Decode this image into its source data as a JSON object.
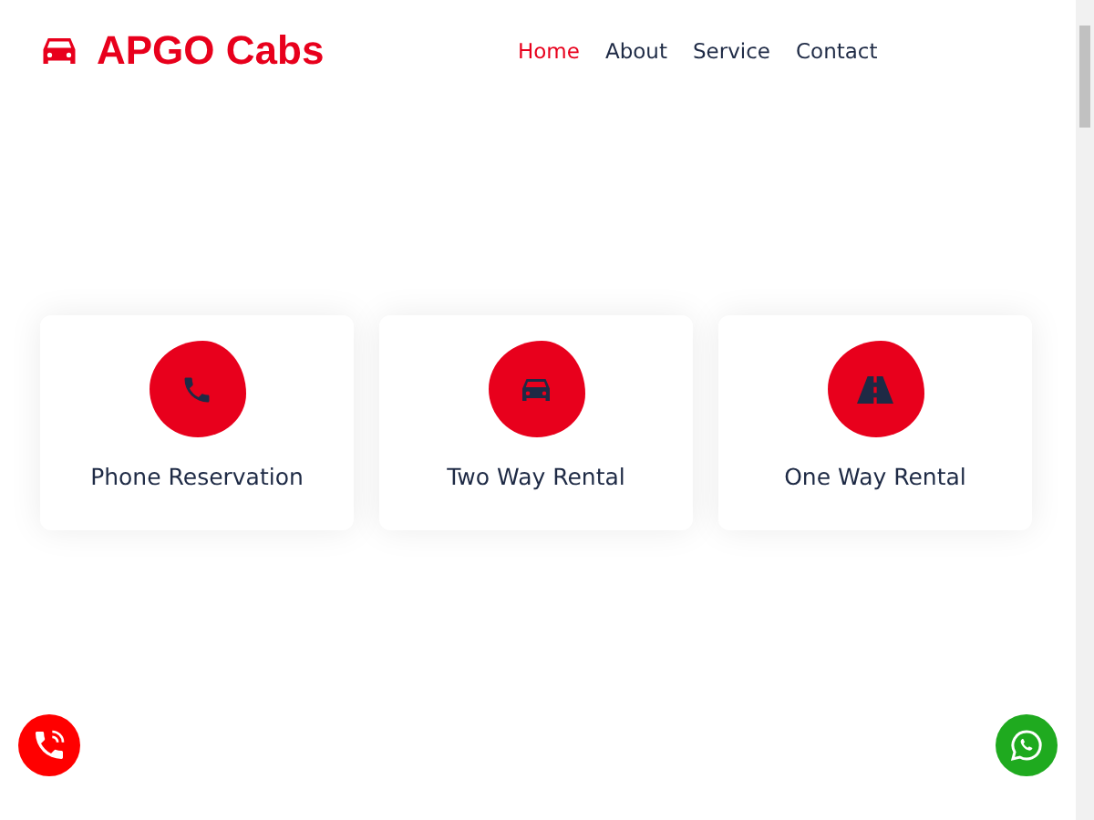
{
  "brand": {
    "name": "APGO Cabs"
  },
  "nav": [
    {
      "label": "Home",
      "selected": true
    },
    {
      "label": "About",
      "selected": false
    },
    {
      "label": "Service",
      "selected": false
    },
    {
      "label": "Contact",
      "selected": false
    }
  ],
  "services": [
    {
      "kind": "phone",
      "title": "Phone Reservation"
    },
    {
      "kind": "car",
      "title": "Two Way Rental"
    },
    {
      "kind": "road",
      "title": "One Way Rental"
    }
  ]
}
